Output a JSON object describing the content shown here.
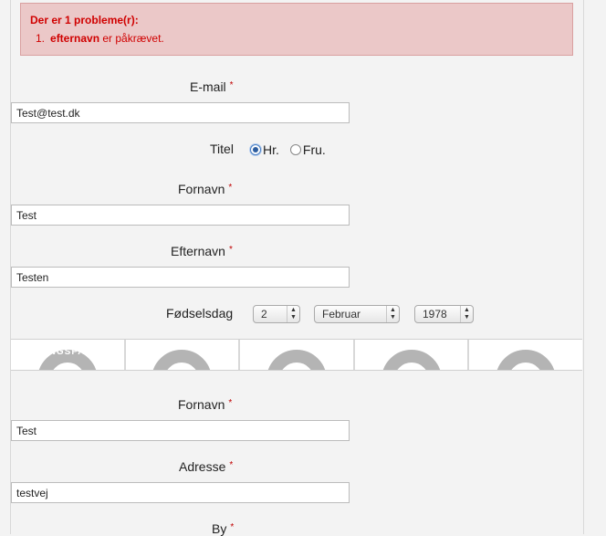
{
  "errors": {
    "title": "Der er 1 probleme(r):",
    "items": [
      {
        "number": "1.",
        "field": "efternavn",
        "message": " er påkrævet."
      }
    ]
  },
  "required_marker": "*",
  "form": {
    "email": {
      "label": "E-mail",
      "value": "Test@test.dk"
    },
    "title": {
      "label": "Titel",
      "options": [
        {
          "label": "Hr.",
          "checked": true
        },
        {
          "label": "Fru.",
          "checked": false
        }
      ]
    },
    "firstname": {
      "label": "Fornavn",
      "value": "Test"
    },
    "lastname": {
      "label": "Efternavn",
      "value": "Testen"
    },
    "birthday": {
      "label": "Fødselsdag",
      "day": "2",
      "month": "Februar",
      "year": "1978"
    },
    "banner": {
      "text": "ERINGSPA"
    },
    "firstname2": {
      "label": "Fornavn",
      "value": "Test"
    },
    "address": {
      "label": "Adresse",
      "value": "testvej"
    },
    "city": {
      "label": "By"
    }
  }
}
